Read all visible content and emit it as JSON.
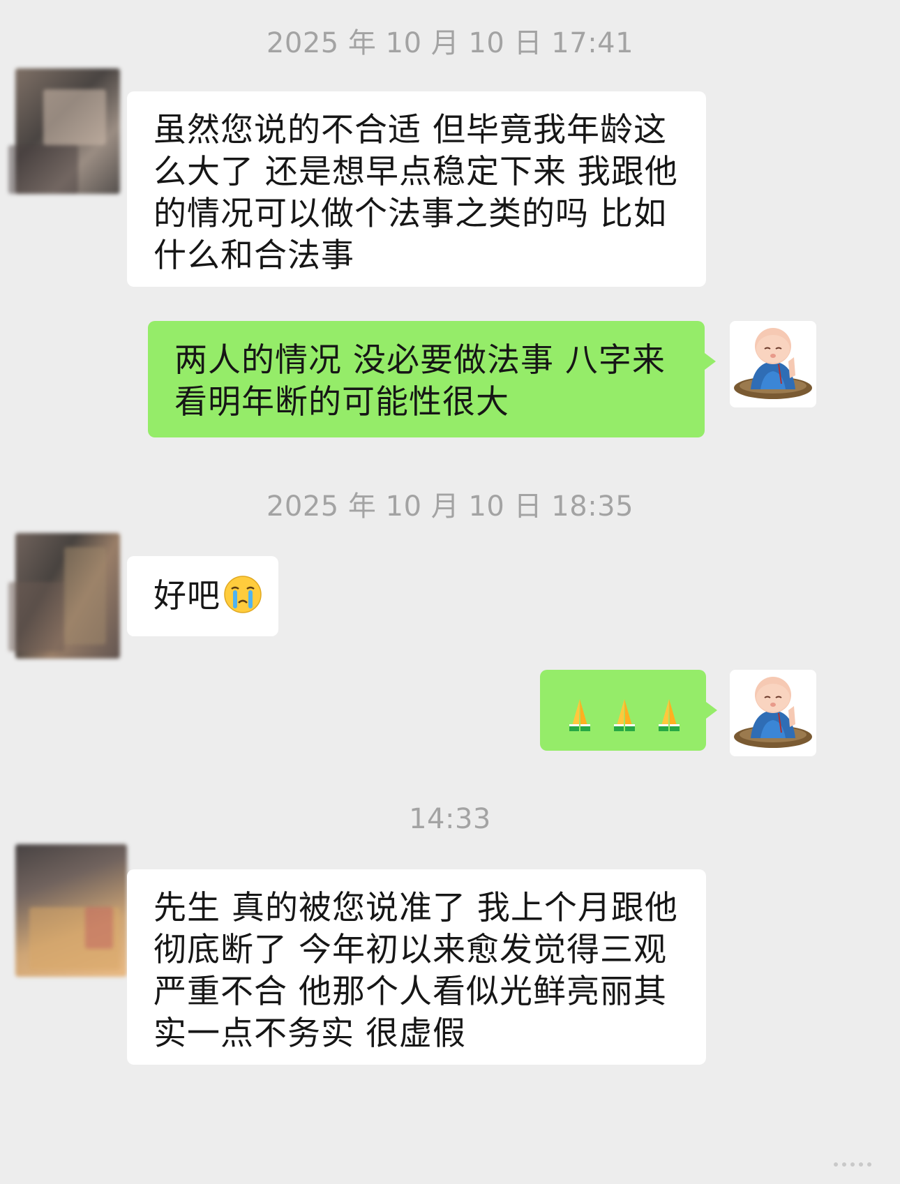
{
  "chat": {
    "timestamps": [
      "2025 年 10 月 10 日  17:41",
      "2025 年 10 月 10 日  18:35",
      "14:33"
    ],
    "messages": [
      {
        "side": "in",
        "text": "虽然您说的不合适 但毕竟我年龄这么大了 还是想早点稳定下来 我跟他的情况可以做个法事之类的吗 比如什么和合法事"
      },
      {
        "side": "out",
        "text": "两人的情况 没必要做法事 八字来看明年断的可能性很大"
      },
      {
        "side": "in",
        "text": "好吧",
        "emoji": "crying-face"
      },
      {
        "side": "out",
        "emoji": "folded-hands",
        "emoji_count": 3
      },
      {
        "side": "in",
        "text": "先生 真的被您说准了 我上个月跟他彻底断了 今年初以来愈发觉得三观严重不合 他那个人看似光鲜亮丽其实一点不务实 很虚假"
      }
    ]
  },
  "colors": {
    "background": "#ededed",
    "incoming_bubble": "#ffffff",
    "outgoing_bubble": "#95ec69",
    "timestamp_text": "#a3a3a3",
    "message_text": "#161616"
  },
  "icons": {
    "self_avatar": "praying-monk-avatar",
    "contact_avatar": "blurred-avatar"
  }
}
